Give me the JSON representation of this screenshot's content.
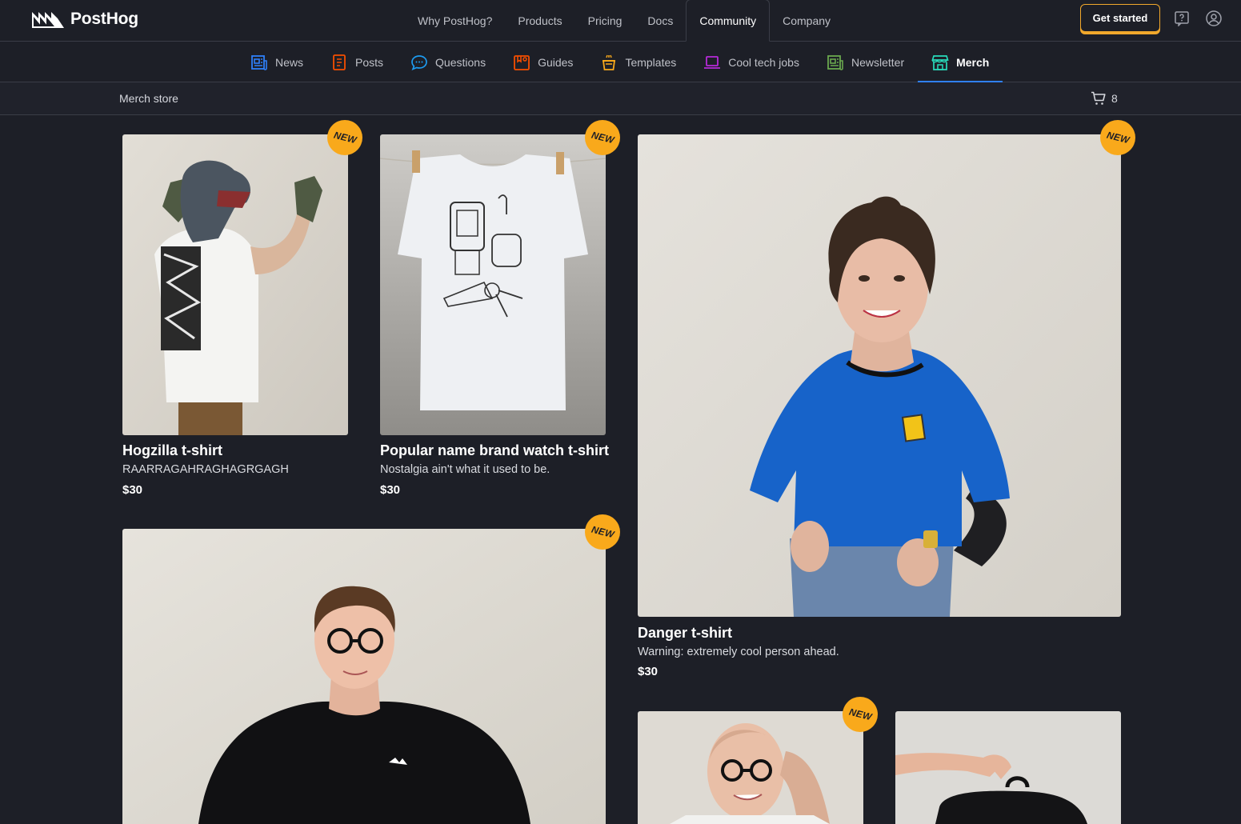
{
  "brand": {
    "name": "PostHog"
  },
  "main_nav": {
    "items": [
      {
        "label": "Why PostHog?"
      },
      {
        "label": "Products"
      },
      {
        "label": "Pricing"
      },
      {
        "label": "Docs"
      },
      {
        "label": "Community",
        "active": true
      },
      {
        "label": "Company"
      }
    ],
    "cta_label": "Get started"
  },
  "sub_nav": {
    "items": [
      {
        "label": "News",
        "icon": "news-icon"
      },
      {
        "label": "Posts",
        "icon": "posts-icon"
      },
      {
        "label": "Questions",
        "icon": "questions-icon"
      },
      {
        "label": "Guides",
        "icon": "guides-icon"
      },
      {
        "label": "Templates",
        "icon": "templates-icon"
      },
      {
        "label": "Cool tech jobs",
        "icon": "laptop-icon"
      },
      {
        "label": "Newsletter",
        "icon": "newsletter-icon"
      },
      {
        "label": "Merch",
        "icon": "store-icon",
        "active": true
      }
    ]
  },
  "store": {
    "title": "Merch store",
    "cart_count": "8"
  },
  "products": [
    {
      "name": "Hogzilla t-shirt",
      "description": "RAARRAGAHRAGHAGRGAGH",
      "price": "$30",
      "badge": "NEW"
    },
    {
      "name": "Popular name brand watch t-shirt",
      "description": "Nostalgia ain't what it used to be.",
      "price": "$30",
      "badge": "NEW"
    },
    {
      "name": "Danger t-shirt",
      "description": "Warning: extremely cool person ahead.",
      "price": "$30",
      "badge": "NEW"
    },
    {
      "name": "",
      "description": "",
      "price": "",
      "badge": "NEW"
    },
    {
      "name": "",
      "description": "",
      "price": "",
      "badge": "NEW"
    },
    {
      "name": "",
      "description": "",
      "price": "",
      "badge": ""
    }
  ],
  "colors": {
    "background": "#1d1f27",
    "accent": "#f9a91b",
    "active_tab": "#2f80fa"
  }
}
